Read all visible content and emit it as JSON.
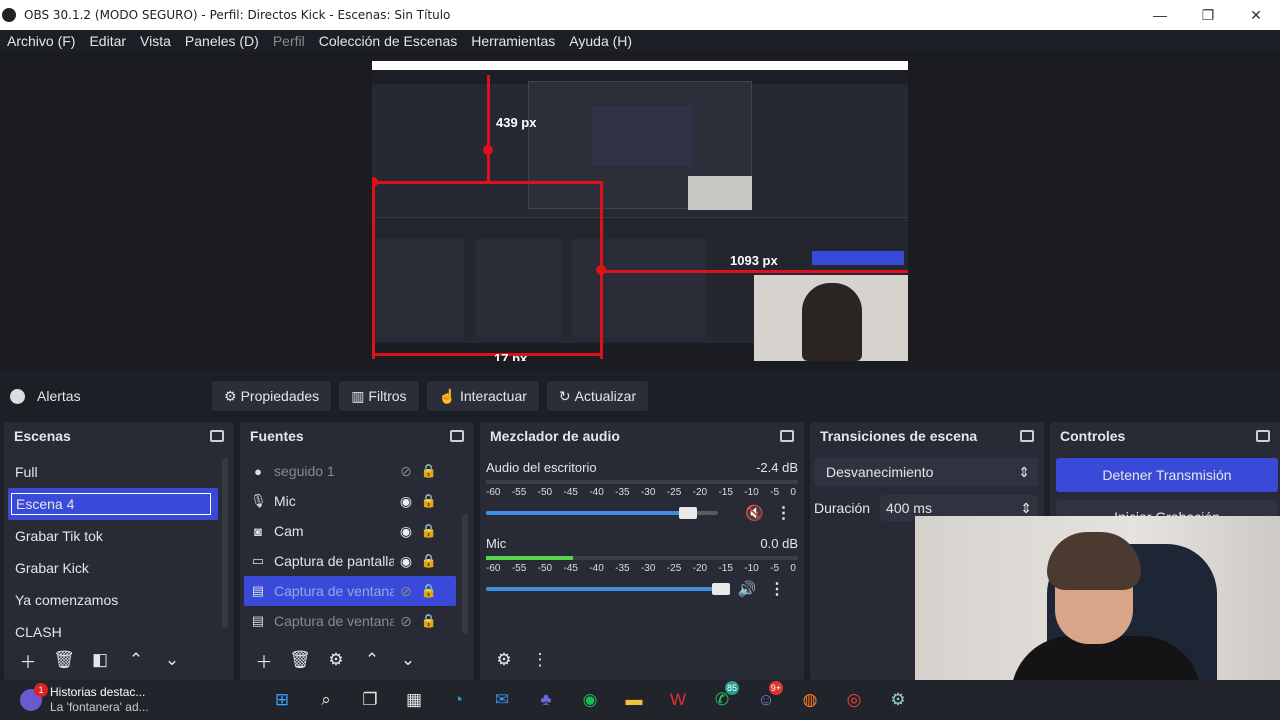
{
  "window": {
    "title": "OBS 30.1.2 (MODO SEGURO) - Perfil: Directos Kick - Escenas: Sin Título",
    "minimize": "—",
    "maximize": "❐",
    "close": "✕"
  },
  "menu": [
    "Archivo (F)",
    "Editar",
    "Vista",
    "Paneles (D)",
    "Perfil",
    "Colección de Escenas",
    "Herramientas",
    "Ayuda (H)"
  ],
  "preview": {
    "measure_top": "439 px",
    "measure_right": "1093 px",
    "measure_bottom": "17 px"
  },
  "scene_bar": {
    "current_source": "Alertas",
    "properties": "Propiedades",
    "filters": "Filtros",
    "interact": "Interactuar",
    "refresh": "Actualizar"
  },
  "scenes": {
    "title": "Escenas",
    "items": [
      "Full",
      "Escena 4",
      "Grabar Tik tok",
      "Grabar Kick",
      "Ya comenzamos",
      "CLASH"
    ],
    "selected": "Escena 4"
  },
  "sources": {
    "title": "Fuentes",
    "items": [
      {
        "label": "seguido 1",
        "icon": "globe-icon",
        "visible": false
      },
      {
        "label": "Mic",
        "icon": "mic-icon",
        "visible": true
      },
      {
        "label": "Cam",
        "icon": "camera-icon",
        "visible": true
      },
      {
        "label": "Captura de pantalla",
        "icon": "monitor-icon",
        "visible": true
      },
      {
        "label": "Captura de ventana",
        "icon": "window-icon",
        "visible": false
      },
      {
        "label": "Captura de ventana",
        "icon": "window-icon",
        "visible": false
      }
    ]
  },
  "mixer": {
    "title": "Mezclador de audio",
    "scale": [
      "-60",
      "-55",
      "-50",
      "-45",
      "-40",
      "-35",
      "-30",
      "-25",
      "-20",
      "-15",
      "-10",
      "-5",
      "0"
    ],
    "channels": [
      {
        "name": "Audio del escritorio",
        "db": "-2.4 dB",
        "volume": 0.87,
        "muted": true,
        "level": 0.0
      },
      {
        "name": "Mic",
        "db": "0.0 dB",
        "volume": 0.98,
        "muted": false,
        "level": 0.3
      }
    ]
  },
  "transitions": {
    "title": "Transiciones de escena",
    "selected": "Desvanecimiento",
    "duration_label": "Duración",
    "duration_value": "400 ms"
  },
  "controls": {
    "title": "Controles",
    "stop_stream": "Detener Transmisión",
    "start_recording": "Iniciar Grabación"
  },
  "taskbar": {
    "notification_title": "Historias destac...",
    "notification_body": "La 'fontanera' ad...",
    "notification_badge": "1",
    "whatsapp_badge": "85",
    "discord_badge": "9+"
  },
  "colors": {
    "accent": "#3a4ad8",
    "measure_red": "#e0101a",
    "background": "#1d1f26",
    "dock": "#282a35"
  }
}
